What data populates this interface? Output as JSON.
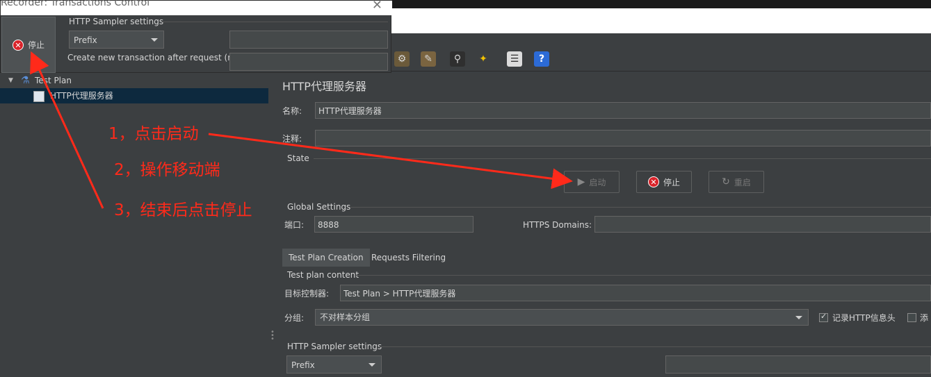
{
  "recorder": {
    "title": "Recorder: Transactions Control",
    "stop_label": "停止",
    "sampler_group": "HTTP Sampler settings",
    "prefix_value": "Prefix",
    "prefix_text": "",
    "create_label": "Create new transaction after request (ms):",
    "create_value": ""
  },
  "tree": {
    "items": [
      {
        "label": "Test Plan"
      },
      {
        "label": "HTTP代理服务器"
      }
    ]
  },
  "toolbar": {
    "icons": [
      "settings-icon",
      "clear-icon",
      "search-icon",
      "broom-icon",
      "list-icon",
      "help-icon"
    ]
  },
  "panel": {
    "title": "HTTP代理服务器",
    "name_label": "名称:",
    "name_value": "HTTP代理服务器",
    "comment_label": "注释:",
    "comment_value": "",
    "state_label": "State",
    "start_label": "启动",
    "stop_label": "停止",
    "restart_label": "重启",
    "global_label": "Global Settings",
    "port_label": "端口:",
    "port_value": "8888",
    "https_label": "HTTPS Domains:",
    "https_value": "",
    "tabs": [
      "Test Plan Creation",
      "Requests Filtering"
    ],
    "content_group": "Test plan content",
    "target_label": "目标控制器:",
    "target_value": "Test Plan > HTTP代理服务器",
    "group_label": "分组:",
    "group_value": "不对样本分组",
    "record_headers_label": "记录HTTP信息头",
    "add_label": "添",
    "sampler_group": "HTTP Sampler settings",
    "prefix_value": "Prefix"
  },
  "annotations": {
    "step1": "1，点击启动",
    "step2": "2，操作移动端",
    "step3": "3，结束后点击停止"
  },
  "colors": {
    "annotation": "#ff2a1a",
    "background": "#3c3f41",
    "selection": "#0d293e",
    "stop_red": "#d9232a"
  }
}
